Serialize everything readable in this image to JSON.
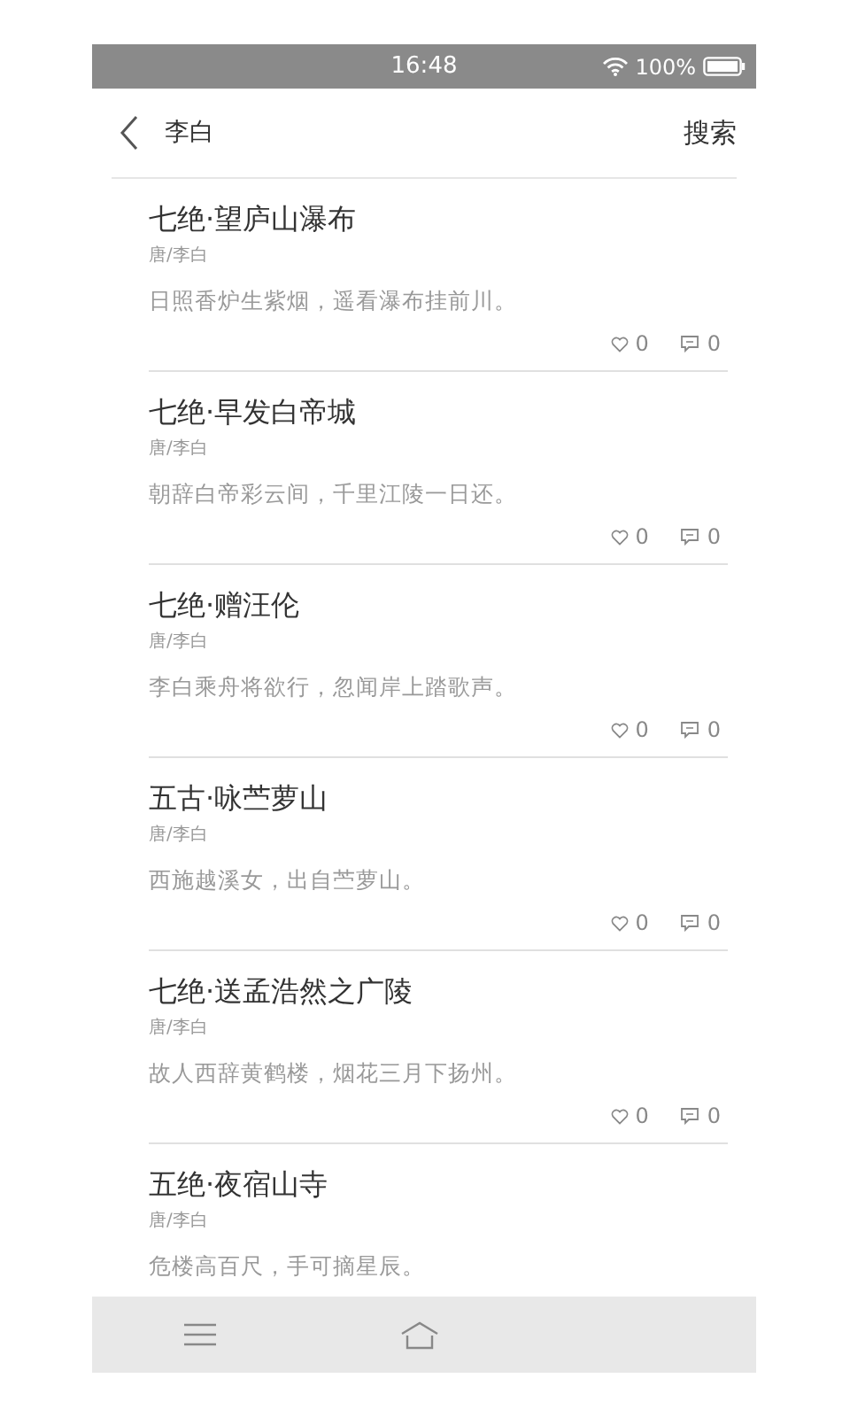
{
  "status_bar": {
    "time": "16:48",
    "battery": "100%"
  },
  "header": {
    "title": "李白",
    "action": "搜索"
  },
  "poems": [
    {
      "title": "七绝·望庐山瀑布",
      "author": "唐/李白",
      "excerpt": "日照香炉生紫烟，遥看瀑布挂前川。",
      "likes": "0",
      "comments": "0"
    },
    {
      "title": "七绝·早发白帝城",
      "author": "唐/李白",
      "excerpt": "朝辞白帝彩云间，千里江陵一日还。",
      "likes": "0",
      "comments": "0"
    },
    {
      "title": "七绝·赠汪伦",
      "author": "唐/李白",
      "excerpt": "李白乘舟将欲行，忽闻岸上踏歌声。",
      "likes": "0",
      "comments": "0"
    },
    {
      "title": "五古·咏苎萝山",
      "author": "唐/李白",
      "excerpt": "西施越溪女，出自苎萝山。",
      "likes": "0",
      "comments": "0"
    },
    {
      "title": "七绝·送孟浩然之广陵",
      "author": "唐/李白",
      "excerpt": "故人西辞黄鹤楼，烟花三月下扬州。",
      "likes": "0",
      "comments": "0"
    },
    {
      "title": "五绝·夜宿山寺",
      "author": "唐/李白",
      "excerpt": "危楼高百尺，手可摘星辰。"
    }
  ]
}
